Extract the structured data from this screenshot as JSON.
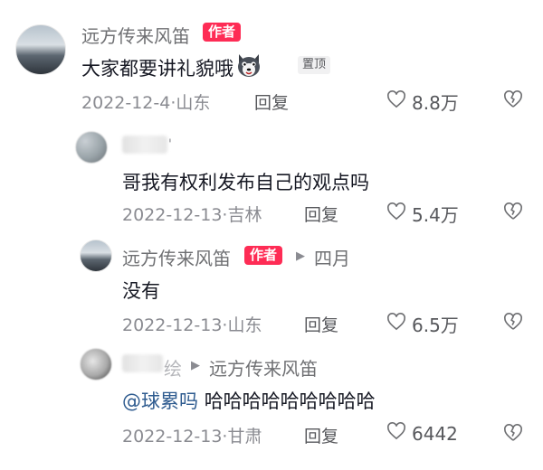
{
  "comments": [
    {
      "name": "远方传来风笛",
      "author_badge": "作者",
      "text": "大家都要讲礼貌哦",
      "pinned_label": "置顶",
      "date": "2022-12-4",
      "location": "山东",
      "reply_label": "回复",
      "likes": "8.8万"
    },
    {
      "name_suffix": "'",
      "text": "哥我有权利发布自己的观点吗",
      "date": "2022-12-13",
      "location": "吉林",
      "reply_label": "回复",
      "likes": "5.4万"
    },
    {
      "name": "远方传来风笛",
      "author_badge": "作者",
      "reply_to": "四月",
      "text": "没有",
      "date": "2022-12-13",
      "location": "山东",
      "reply_label": "回复",
      "likes": "6.5万"
    },
    {
      "name_tail": "绘",
      "reply_to": "远方传来风笛",
      "mention": "@球累吗",
      "text": "哈哈哈哈哈哈哈哈哈",
      "date": "2022-12-13",
      "location": "甘肃",
      "reply_label": "回复",
      "likes": "6442"
    }
  ],
  "separator": "·",
  "icons": {
    "like": "heart-outline-icon",
    "dislike": "broken-heart-icon",
    "reply_arrow": "triangle-right-icon",
    "emoji": "husky-dog-emoji-icon"
  },
  "colors": {
    "author_badge": "#fe2c55",
    "mention": "#2e5b8f"
  }
}
